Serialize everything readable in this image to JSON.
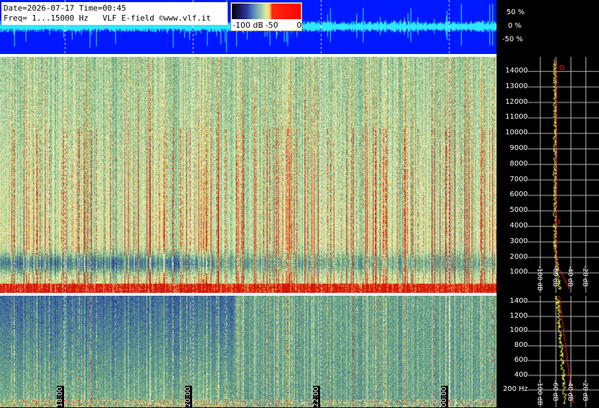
{
  "header": {
    "date_line": "Date=2026-07-17 Time=00:45",
    "freq_line": "Freq= 1...15000 Hz   VLF E-field ©www.vlf.it"
  },
  "colorbar": {
    "labels": [
      "-100 dB",
      "-50",
      "0"
    ]
  },
  "waveform": {
    "percent_labels": [
      "50 %",
      "0 %",
      "-50 %"
    ]
  },
  "upper_panel": {
    "freq_labels": [
      "14000",
      "13000",
      "12000",
      "11000",
      "10000",
      "9000",
      "8000",
      "7000",
      "6000",
      "5000",
      "4000",
      "3000",
      "2000",
      "1000"
    ],
    "db_labels": [
      "-100 dB",
      "-60 dB",
      "-40 dB",
      "-20 dB"
    ]
  },
  "lower_panel": {
    "freq_labels": [
      "1400",
      "1200",
      "1000",
      "800",
      "600",
      "400",
      "200 Hz"
    ],
    "db_labels": [
      "-100 dB",
      "-60 dB",
      "-40 dB",
      "-20 dB"
    ]
  },
  "time_labels": [
    "18:00",
    "20:00",
    "22:00",
    "00:00"
  ],
  "colors": {
    "wave_bg": "#0018ff",
    "wave_trace": "#2ee8ff",
    "profile_avg": "#ffff40",
    "profile_peak": "#ff2020"
  }
}
